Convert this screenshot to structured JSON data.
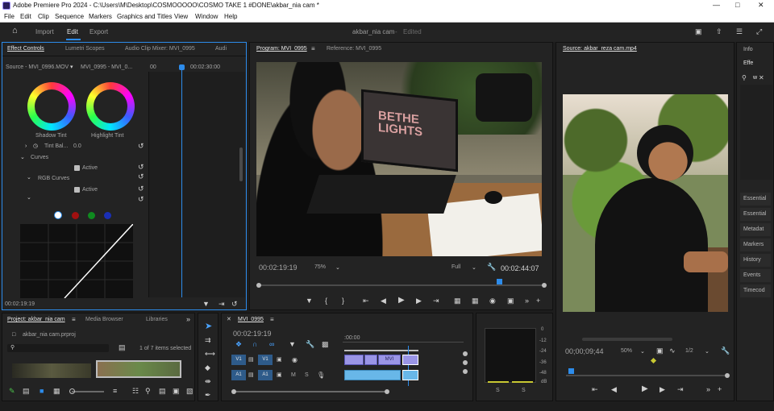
{
  "app": {
    "title": "Adobe Premiere Pro 2024 - C:\\Users\\M\\Desktop\\COSMOOOOO\\COSMO TAKE 1 #DONE\\akbar_nia cam *"
  },
  "menu": [
    "File",
    "Edit",
    "Clip",
    "Sequence",
    "Markers",
    "Graphics and Titles",
    "View",
    "Window",
    "Help"
  ],
  "workspace": {
    "tabs": [
      "Import",
      "Edit",
      "Export"
    ],
    "active": "Edit",
    "project_name": "akbar_nia cam",
    "status": "Edited"
  },
  "effect_controls": {
    "tabs": [
      "Effect Controls",
      "Lumetri Scopes",
      "Audio Clip Mixer: MVI_0995",
      "Audi"
    ],
    "source": "Source - MVI_0996.MOV",
    "sequence": "MVI_0995 - MVI_0...",
    "time_start": "00",
    "time_ruler": "00:02:30:00",
    "shadow_tint": "Shadow Tint",
    "highlight_tint": "Highlight Tint",
    "tint_balance_label": "Tint Bal...",
    "tint_balance_value": "0.0",
    "curves": "Curves",
    "active1": "Active",
    "rgb_curves": "RGB Curves",
    "active2": "Active",
    "timecode": "00:02:19:19"
  },
  "program_monitor": {
    "tabs": [
      "Program: MVI_0995",
      "Reference: MVI_0995"
    ],
    "timecode": "00:02:19:19",
    "zoom": "75%",
    "quality": "Full",
    "duration": "00:02:44:07",
    "playhead_fraction": 0.84
  },
  "source_monitor": {
    "tab": "Source: akbar_reza cam.mp4",
    "timecode": "00;00;09;44",
    "zoom": "50%",
    "resolution": "1/2",
    "playhead_fraction": 0.03
  },
  "right_panel": {
    "tabs": [
      "Info",
      "Effe"
    ],
    "search_value": "w",
    "items": [
      "Essential",
      "Essential",
      "Metadat",
      "Markers",
      "History",
      "Events",
      "Timecod"
    ]
  },
  "project": {
    "tabs": [
      "Project: akbar_nia cam",
      "Media Browser",
      "Libraries"
    ],
    "file": "akbar_nia cam.prproj",
    "selection": "1 of 7 items selected"
  },
  "timeline": {
    "tab": "MVI_0995",
    "timecode": "00:02:19:19",
    "ruler": ":00:00",
    "tracks": [
      {
        "name": "V1",
        "label": "V1"
      },
      {
        "name": "A1",
        "label": "A1"
      }
    ],
    "clip_label": "MVI",
    "track_btn_m": "M",
    "track_btn_s": "S"
  },
  "audio_meter": {
    "scale": [
      "0",
      "-12",
      "-24",
      "-36",
      "-48",
      "dB"
    ],
    "solo_left": "S",
    "solo_right": "S"
  },
  "colors": {
    "accent": "#2d8ceb",
    "timecode": "#4aa3ff",
    "video_clip": "#9a95e6",
    "audio_clip": "#68b7e8"
  }
}
